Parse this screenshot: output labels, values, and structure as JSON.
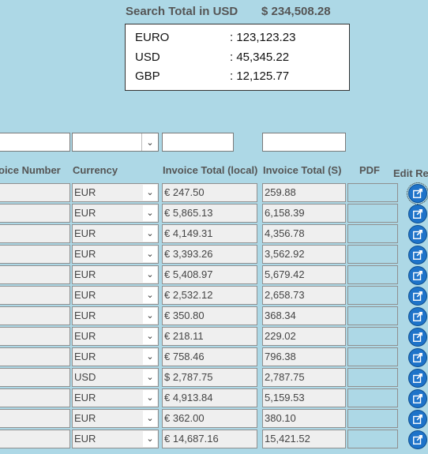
{
  "summary": {
    "title": "Search Total in USD",
    "total": "$ 234,508.28",
    "currencies": [
      {
        "code": "EURO",
        "amount": ": 123,123.23"
      },
      {
        "code": "USD",
        "amount": ": 45,345.22"
      },
      {
        "code": "GBP",
        "amount": ": 12,125.77"
      }
    ]
  },
  "columns": {
    "invoice_number": "oice Number",
    "currency": "Currency",
    "total_local": "Invoice Total (local)",
    "total_usd": "Invoice Total (S)",
    "pdf": "PDF",
    "edit": "Edit Re"
  },
  "filters": {
    "invoice_number": "",
    "currency": "",
    "total_local": "",
    "total_usd": ""
  },
  "icons": {
    "dropdown": "chevron-down-icon",
    "edit": "edit-icon"
  },
  "rows": [
    {
      "currency": "EUR",
      "local": "€ 247.50",
      "usd": "259.88"
    },
    {
      "currency": "EUR",
      "local": "€ 5,865.13",
      "usd": "6,158.39"
    },
    {
      "currency": "EUR",
      "local": "€ 4,149.31",
      "usd": "4,356.78"
    },
    {
      "currency": "EUR",
      "local": "€ 3,393.26",
      "usd": "3,562.92"
    },
    {
      "currency": "EUR",
      "local": "€ 5,408.97",
      "usd": "5,679.42"
    },
    {
      "currency": "EUR",
      "local": "€ 2,532.12",
      "usd": "2,658.73"
    },
    {
      "currency": "EUR",
      "local": "€ 350.80",
      "usd": "368.34"
    },
    {
      "currency": "EUR",
      "local": "€ 218.11",
      "usd": "229.02"
    },
    {
      "currency": "EUR",
      "local": "€ 758.46",
      "usd": "796.38"
    },
    {
      "currency": "USD",
      "local": "$ 2,787.75",
      "usd": "2,787.75"
    },
    {
      "currency": "EUR",
      "local": "€ 4,913.84",
      "usd": "5,159.53"
    },
    {
      "currency": "EUR",
      "local": "€ 362.00",
      "usd": "380.10"
    },
    {
      "currency": "EUR",
      "local": "€ 14,687.16",
      "usd": "15,421.52"
    }
  ]
}
